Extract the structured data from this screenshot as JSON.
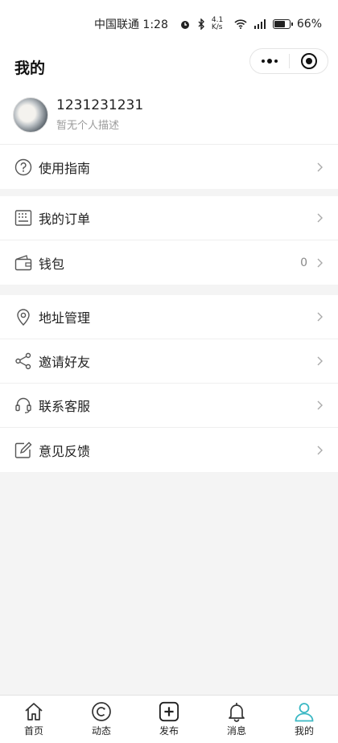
{
  "status_bar": {
    "carrier_time": "中国联通 1:28",
    "net_speed": "4.1 K/s",
    "battery": "66%"
  },
  "nav": {
    "title": "我的"
  },
  "profile": {
    "name": "1231231231",
    "description": "暂无个人描述"
  },
  "menu": {
    "guide": "使用指南",
    "orders": "我的订单",
    "wallet": "钱包",
    "wallet_value": "0",
    "address": "地址管理",
    "invite": "邀请好友",
    "service": "联系客服",
    "feedback": "意见反馈"
  },
  "tabs": [
    {
      "label": "首页",
      "icon": "home-icon"
    },
    {
      "label": "动态",
      "icon": "feed-icon"
    },
    {
      "label": "发布",
      "icon": "publish-icon"
    },
    {
      "label": "消息",
      "icon": "bell-icon"
    },
    {
      "label": "我的",
      "icon": "user-icon"
    }
  ],
  "colors": {
    "accent": "#3bb8c4",
    "icon": "#555555"
  }
}
